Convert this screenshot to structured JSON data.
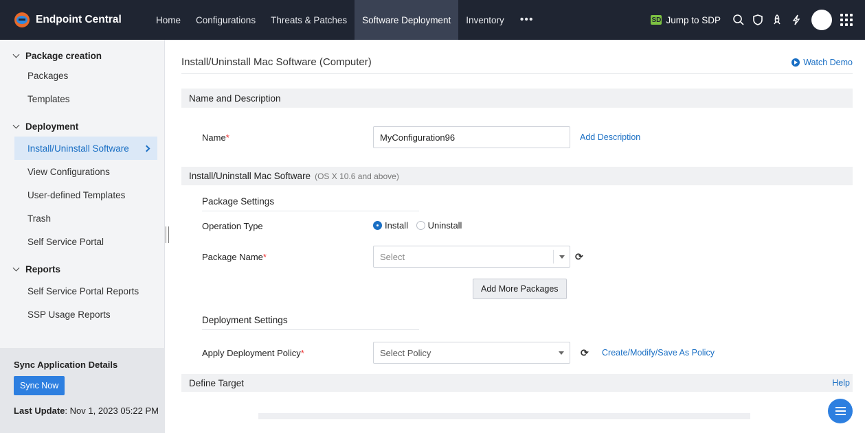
{
  "app": {
    "name": "Endpoint Central"
  },
  "nav": [
    {
      "label": "Home"
    },
    {
      "label": "Configurations"
    },
    {
      "label": "Threats & Patches"
    },
    {
      "label": "Software Deployment"
    },
    {
      "label": "Inventory"
    }
  ],
  "nav_more": "•••",
  "topright": {
    "sdp_label": "Jump to SDP",
    "sdp_icon_text": "SD"
  },
  "sidebar": {
    "groups": [
      {
        "label": "Package creation",
        "items": [
          "Packages",
          "Templates"
        ]
      },
      {
        "label": "Deployment",
        "items": [
          "Install/Uninstall Software",
          "View Configurations",
          "User-defined Templates",
          "Trash",
          "Self Service Portal"
        ]
      },
      {
        "label": "Reports",
        "items": [
          "Self Service Portal Reports",
          "SSP Usage Reports"
        ]
      }
    ],
    "sync": {
      "title": "Sync Application Details",
      "button": "Sync Now",
      "last_label": "Last Update",
      "last_value": ": Nov 1, 2023 05:22 PM"
    }
  },
  "main": {
    "title": "Install/Uninstall Mac Software (Computer)",
    "watch_demo": "Watch Demo",
    "sections": {
      "name_desc": "Name and Description",
      "mac": "Install/Uninstall Mac Software",
      "mac_sub": "(OS X 10.6 and above)",
      "target": "Define Target",
      "target_help": "Help"
    },
    "name_label": "Name",
    "name_value": "MyConfiguration96",
    "add_description": "Add Description",
    "package_settings": "Package Settings",
    "operation_label": "Operation Type",
    "op_install": "Install",
    "op_uninstall": "Uninstall",
    "package_label": "Package Name",
    "package_placeholder": "Select",
    "add_more": "Add More Packages",
    "deployment_settings": "Deployment Settings",
    "policy_label": "Apply Deployment Policy",
    "policy_placeholder": "Select Policy",
    "policy_link": "Create/Modify/Save As Policy",
    "required_mark": "*"
  }
}
